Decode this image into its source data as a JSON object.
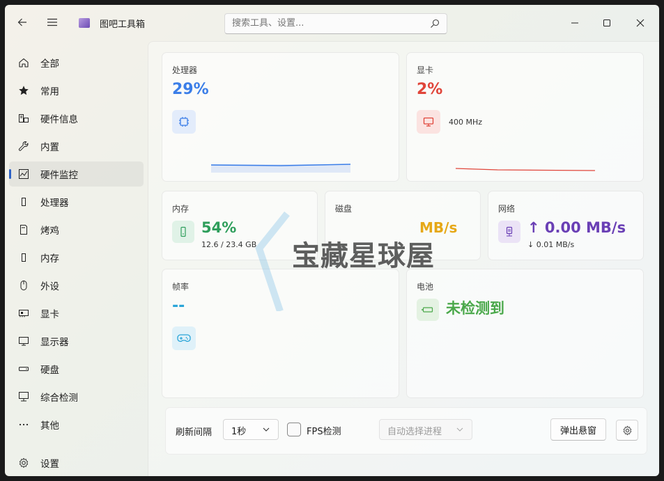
{
  "app": {
    "title": "图吧工具箱",
    "search_placeholder": "搜索工具、设置..."
  },
  "sidebar": {
    "items": [
      {
        "label": "全部",
        "icon": "home-icon"
      },
      {
        "label": "常用",
        "icon": "star-icon"
      },
      {
        "label": "硬件信息",
        "icon": "hardware-info-icon"
      },
      {
        "label": "内置",
        "icon": "wrench-icon"
      },
      {
        "label": "硬件监控",
        "icon": "monitor-chart-icon",
        "active": true
      },
      {
        "label": "处理器",
        "icon": "cpu-icon"
      },
      {
        "label": "烤鸡",
        "icon": "stress-test-icon"
      },
      {
        "label": "内存",
        "icon": "memory-icon"
      },
      {
        "label": "外设",
        "icon": "mouse-icon"
      },
      {
        "label": "显卡",
        "icon": "gpu-icon"
      },
      {
        "label": "显示器",
        "icon": "display-icon"
      },
      {
        "label": "硬盘",
        "icon": "disk-icon"
      },
      {
        "label": "综合检测",
        "icon": "computer-icon"
      },
      {
        "label": "其他",
        "icon": "more-icon"
      }
    ],
    "settings_label": "设置"
  },
  "cards": {
    "cpu": {
      "title": "处理器",
      "value": "29%",
      "color": "#3b7ee8",
      "usage_fraction": 0.29
    },
    "gpu": {
      "title": "显卡",
      "value": "2%",
      "color": "#e0453a",
      "sub": "400 MHz",
      "usage_fraction": 0.02
    },
    "memory": {
      "title": "内存",
      "value": "54%",
      "color": "#2e9e5b",
      "sub": "12.6 / 23.4 GB"
    },
    "disk": {
      "title": "磁盘",
      "value": "MB/s",
      "color": "#e6a817"
    },
    "network": {
      "title": "网络",
      "value": "↑ 0.00 MB/s",
      "color": "#6a3fb5",
      "sub": "↓ 0.01 MB/s"
    },
    "fps": {
      "title": "帧率",
      "value": "--",
      "color": "#2aa5d8"
    },
    "battery": {
      "title": "电池",
      "value": "未检测到",
      "color": "#4aa84a"
    }
  },
  "bottom": {
    "refresh_label": "刷新间隔",
    "refresh_value": "1秒",
    "fps_label": "FPS检测",
    "process_placeholder": "自动选择进程",
    "popup_button": "弹出悬窗"
  },
  "watermark": "宝藏星球屋"
}
